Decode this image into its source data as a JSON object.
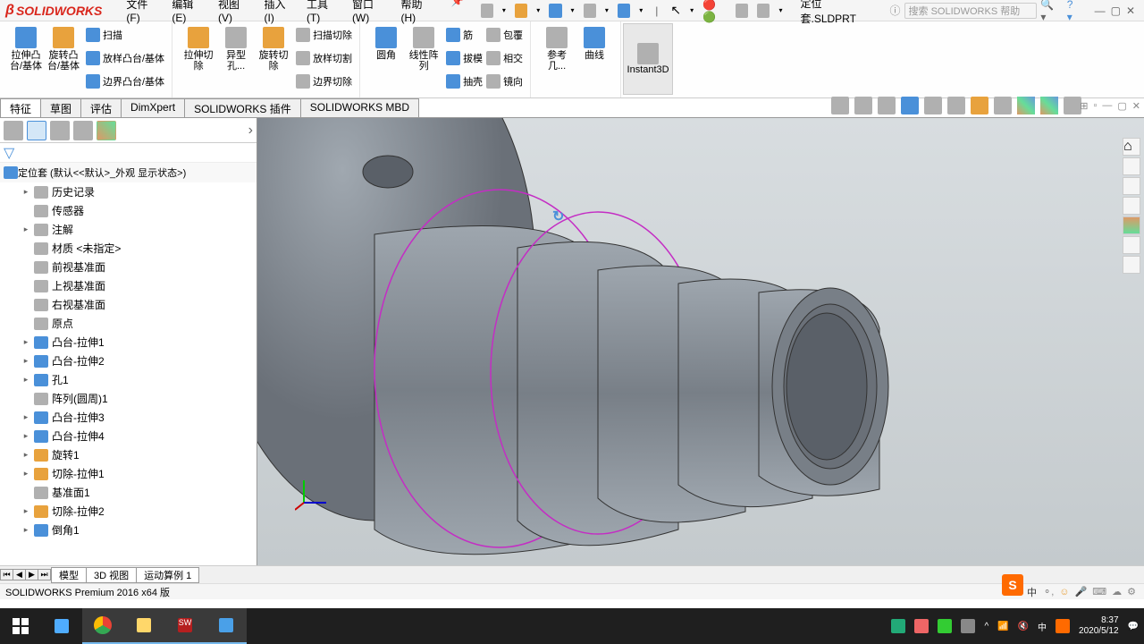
{
  "app": {
    "brand": "SOLIDWORKS"
  },
  "menu": {
    "file": "文件(F)",
    "edit": "编辑(E)",
    "view": "视图(V)",
    "insert": "插入(I)",
    "tools": "工具(T)",
    "window": "窗口(W)",
    "help": "帮助(H)"
  },
  "document": {
    "name": "定位套.SLDPRT"
  },
  "search": {
    "placeholder": "搜索 SOLIDWORKS 帮助"
  },
  "ribbon": {
    "extrude": "拉伸凸台/基体",
    "revolve": "旋转凸台/基体",
    "sweep": "扫描",
    "loft": "放样凸台/基体",
    "boundary": "边界凸台/基体",
    "cut_extrude": "拉伸切除",
    "hole": "异型孔...",
    "cut_revolve": "旋转切除",
    "cut_sweep": "扫描切除",
    "cut_loft": "放样切割",
    "cut_boundary": "边界切除",
    "fillet": "圆角",
    "pattern": "线性阵列",
    "rib": "筋",
    "draft": "拔模",
    "shell": "抽壳",
    "wrap": "包覆",
    "intersect": "相交",
    "mirror": "镜向",
    "refgeo": "参考几...",
    "curves": "曲线",
    "instant3d": "Instant3D"
  },
  "tabs": {
    "feature": "特征",
    "sketch": "草图",
    "evaluate": "评估",
    "dimxpert": "DimXpert",
    "addins": "SOLIDWORKS 插件",
    "mbd": "SOLIDWORKS MBD"
  },
  "tree": {
    "root": "定位套  (默认<<默认>_外观 显示状态>)",
    "history": "历史记录",
    "sensors": "传感器",
    "annotations": "注解",
    "material": "材质 <未指定>",
    "front": "前视基准面",
    "top": "上视基准面",
    "right": "右视基准面",
    "origin": "原点",
    "f1": "凸台-拉伸1",
    "f2": "凸台-拉伸2",
    "f3": "孔1",
    "f4": "阵列(圆周)1",
    "f5": "凸台-拉伸3",
    "f6": "凸台-拉伸4",
    "f7": "旋转1",
    "f8": "切除-拉伸1",
    "f9": "基准面1",
    "f10": "切除-拉伸2",
    "f11": "倒角1"
  },
  "bottom_tabs": {
    "model": "模型",
    "view3d": "3D 视图",
    "motion": "运动算例 1"
  },
  "status": {
    "edition": "SOLIDWORKS Premium 2016 x64 版"
  },
  "taskbar": {
    "time": "8:37",
    "date": "2020/5/12",
    "ime1": "中",
    "ime2": "中"
  },
  "sogou": {
    "letter": "S"
  }
}
